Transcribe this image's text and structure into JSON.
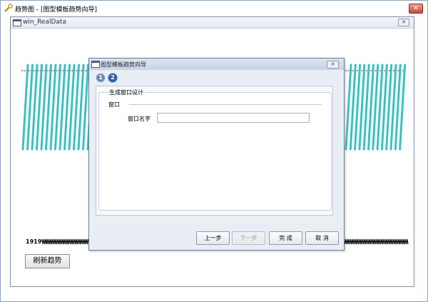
{
  "window": {
    "title": "趋势图 - [图型模板趋势向导]",
    "close_label": "✕"
  },
  "inner_window": {
    "title": "win_RealData",
    "close_label": "✕"
  },
  "trend": {
    "time_label": "1919"
  },
  "refresh_button": {
    "label": "刷新趋势"
  },
  "dialog": {
    "title": "图型模板趋势向导",
    "close_label": "✕",
    "steps": [
      {
        "number": "1"
      },
      {
        "number": "2"
      }
    ],
    "group_title": "生成窗口设计",
    "section_label": "窗口",
    "field_label": "窗口名字",
    "field_value": "",
    "buttons": {
      "prev": "上一步",
      "next": "下一步",
      "finish": "完 成",
      "cancel": "取 消"
    }
  },
  "colors": {
    "trend_line": "#3cc0c0",
    "accent": "#2e5ea8"
  }
}
